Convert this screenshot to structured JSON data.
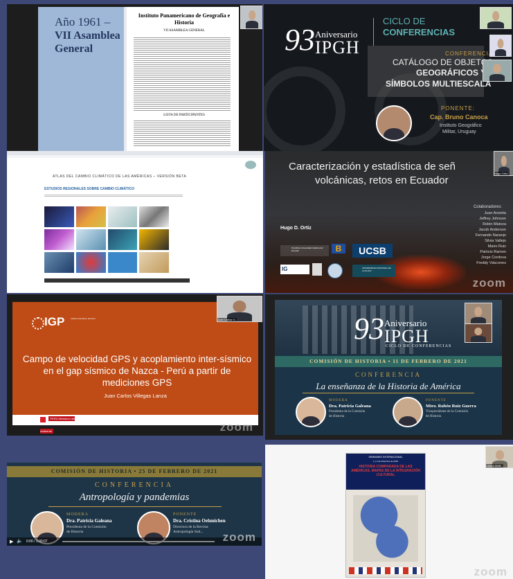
{
  "t1": {
    "slide_year": "Año 1961 –",
    "slide_title": "VII Asamblea General",
    "doc_title": "Instituto Panamericano de Geografía e Historia",
    "doc_subtitle": "VII ASAMBLEA GENERAL",
    "doc_section": "LISTA DE PARTICIPANTES"
  },
  "t2": {
    "num": "93",
    "aniversario": "Aniversario",
    "ipgh": "IPGH",
    "ciclo": "CICLO DE",
    "conferencias": "CONFERENCIAS",
    "conferencia": "CONFERENCIA",
    "catalogo": "CATÁLOGO DE OBJETOS",
    "geo": "GEOGRÁFICOS Y",
    "simbolos": "SÍMBOLOS MULTIESCALA",
    "ponente_label": "PONENTE:",
    "ponente": "Cap. Bruno Canoca",
    "inst1": "Instituto Geográfico",
    "inst2": "Militar, Uruguay"
  },
  "t3": {
    "atlas_title": "ATLAS DEL CAMBIO CLIMÁTICO DE LAS AMÉRICAS – VERSIÓN BETA",
    "estudios": "ESTUDIOS REGIONALES SOBRE CAMBIO CLIMÁTICO"
  },
  "t4": {
    "title1": "Caracterización y estadística de señ",
    "title2": "volcánicas, retos en Ecuador",
    "author": "Hugo D. Ortiz",
    "collab_label": "Colaboradores:",
    "collaborators": [
      "Juan Anzieta",
      "Jeffrey Johnson",
      "Robin Matoza",
      "Jacob Anderson",
      "Fernando Naranjo",
      "Silvia Vallejo",
      "Mario Ruiz",
      "Patricio Ramon",
      "Jorge Cordova",
      "Freddy Vásconez"
    ],
    "ucsb": "UCSB",
    "pucsb": "Pontificia Universidad Católica del Ecuador",
    "unlp": "UNIVERSIDAD NACIONAL DE LA PLATA",
    "participant": "Hugo Ortiz",
    "zoom": "zoom"
  },
  "t5": {
    "logo": "IGP",
    "logo_sub": "Instituto Geofísico del Perú",
    "title": "Campo de velocidad GPS y acoplamiento inter-sísmico en el gap sísmico de Nazca - Perú a partir de mediciones GPS",
    "author": "Juan Carlos Villegas Lanza",
    "participant": "Juan Carlos V...",
    "footer_org": "PERÚ Ministerio del Ambiente",
    "zoom": "zoom"
  },
  "t6": {
    "num": "93",
    "aniversario": "Aniversario",
    "ipgh": "IPGH",
    "ciclo": "CICLO DE CONFERENCIAS",
    "bar": "COMISIÓN DE HISTORIA • 11 DE FEBRERO DE 2021",
    "conferencia": "CONFERENCIA",
    "topic": "La enseñanza de la Historia de América",
    "modera_label": "MODERA",
    "modera_name": "Dra. Patricia Galeana",
    "modera_role1": "Presidenta de la Comisión",
    "modera_role2": "de Historia",
    "ponente_label": "PONENTE",
    "ponente_name": "Mtro. Rubén Ruiz Guerra",
    "ponente_role1": "Vicepresidente de la Comisión",
    "ponente_role2": "de Historia"
  },
  "t7": {
    "bar": "COMISIÓN DE HISTORIA • 25 DE FEBRERO DE 2021",
    "conferencia": "CONFERENCIA",
    "topic": "Antropología y pandemias",
    "modera_label": "MODERA",
    "modera_name": "Dra. Patricia Galeana",
    "modera_role1": "Presidenta de la Comisión",
    "modera_role2": "de Historia",
    "ponente_label": "PONENTE",
    "ponente_name": "Dra. Cristina Oehmichen",
    "ponente_role1": "Directora de la Revista",
    "ponente_role2": "Antropología Sud...",
    "time": "0:00 / 1:00:07",
    "zoom": "zoom"
  },
  "t8": {
    "seminar": "SEMINARIO INTERNACIONAL",
    "dates": "1 y 2 de diciembre de 2016",
    "book_title": "HISTORIA COMPARADA DE LAS AMÉRICAS. MAPAS DE LA INTEGRACIÓN CULTURAL",
    "participant": "Liliana Weill...",
    "zoom": "zoom"
  }
}
